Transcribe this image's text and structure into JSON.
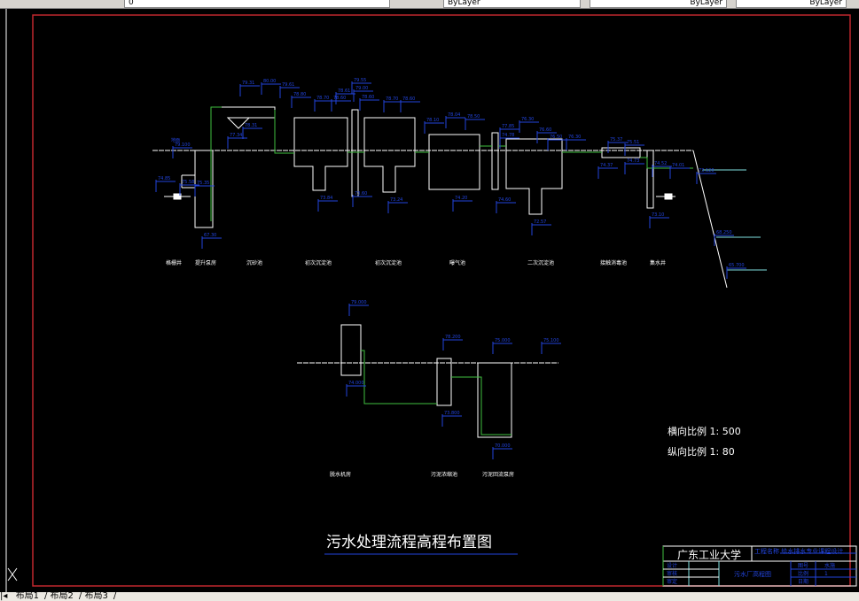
{
  "toolbar": {
    "layer_value": "0",
    "linetype": "ByLayer",
    "lineweight": "ByLayer",
    "plotstyle": "ByLayer"
  },
  "drawing": {
    "title": "污水处理流程高程布置图",
    "scale_h": "横向比例 1: 500",
    "scale_v": "纵向比例 1: 80",
    "ground_label": "地面",
    "units_top": [
      "格栅井",
      "提升泵房",
      "沉砂池",
      "初次沉淀池",
      "初次沉淀池",
      "曝气池",
      "二次沉淀池",
      "接触消毒池",
      "集水井"
    ],
    "units_bottom": [
      "脱水机房",
      "污泥浓缩池",
      "污泥回流泵房"
    ],
    "elevations": [
      "79.31",
      "80.00",
      "79.61",
      "78.80",
      "78.70",
      "78.60",
      "78.61",
      "79.55",
      "79.00",
      "78.60",
      "78.70",
      "78.60",
      "78.10",
      "78.04",
      "78.50",
      "77.85",
      "76.30",
      "74.78",
      "76.60",
      "76.50",
      "76.30",
      "75.37",
      "75.51",
      "74.37",
      "74.73",
      "74.52",
      "74.01",
      "73.120",
      "68.250",
      "65.700",
      "79.100",
      "77.34",
      "78.31",
      "74.85",
      "75.58",
      "75.35",
      "67.30",
      "73.84",
      "73.60",
      "73.24",
      "74.20",
      "74.60",
      "72.57",
      "73.10",
      "79.000",
      "74.000",
      "78.200",
      "73.800",
      "75.000",
      "75.100",
      "70.000"
    ]
  },
  "title_block": {
    "school": "广东工业大学",
    "project": "工程名称  给水排水专业课程设计",
    "drawing_name": "污水厂高程图",
    "roles": [
      "设计",
      "审核",
      "审定"
    ],
    "info_labels": [
      "图号",
      "比例",
      "日期"
    ],
    "info_values": [
      "水施",
      "1"
    ]
  },
  "tabs": [
    "布局1",
    "布局2",
    "布局3"
  ],
  "colors": {
    "frame": "#c0272d",
    "line": "#ffffff",
    "pipe": "#3fc13f",
    "dim": "#2244dd",
    "water": "#7fe0e0"
  }
}
